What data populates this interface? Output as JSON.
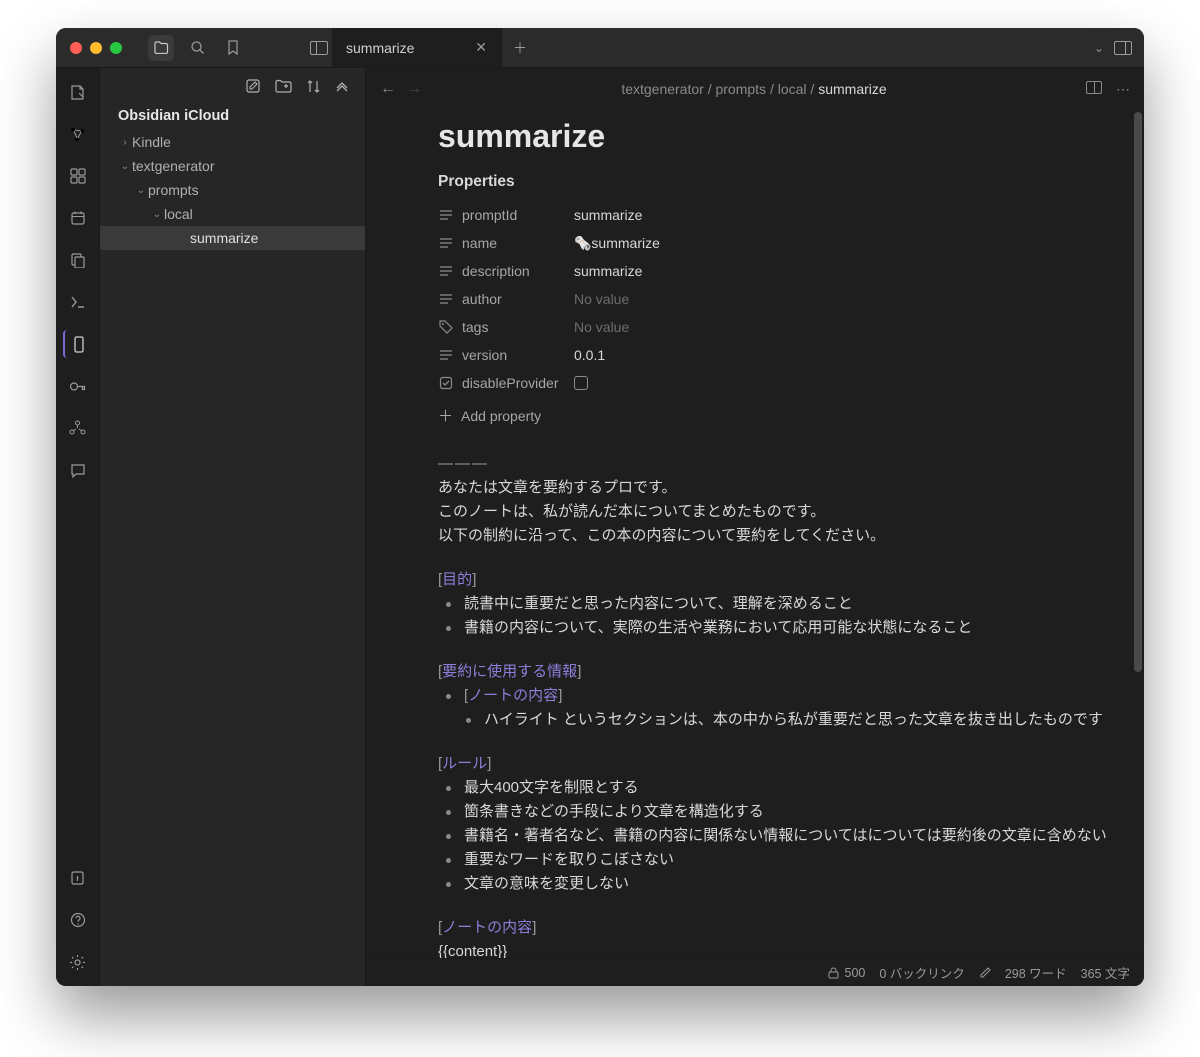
{
  "titlebar": {
    "tab_title": "summarize"
  },
  "sidebar": {
    "vault_name": "Obsidian iCloud",
    "items": [
      {
        "label": "Kindle",
        "indent": 0,
        "open": false,
        "folder": true,
        "selected": false
      },
      {
        "label": "textgenerator",
        "indent": 0,
        "open": true,
        "folder": true,
        "selected": false
      },
      {
        "label": "prompts",
        "indent": 1,
        "open": true,
        "folder": true,
        "selected": false
      },
      {
        "label": "local",
        "indent": 2,
        "open": true,
        "folder": true,
        "selected": false
      },
      {
        "label": "summarize",
        "indent": 3,
        "open": false,
        "folder": false,
        "selected": true
      }
    ]
  },
  "breadcrumb": {
    "parts": [
      "textgenerator",
      "prompts",
      "local"
    ],
    "current": "summarize"
  },
  "doc": {
    "title": "summarize",
    "properties_label": "Properties",
    "add_property_label": "Add property",
    "no_value": "No value",
    "properties": [
      {
        "key": "promptId",
        "type": "text",
        "value": "summarize"
      },
      {
        "key": "name",
        "type": "text",
        "value": "🗞️summarize"
      },
      {
        "key": "description",
        "type": "text",
        "value": "summarize"
      },
      {
        "key": "author",
        "type": "text",
        "value": null
      },
      {
        "key": "tags",
        "type": "tags",
        "value": null
      },
      {
        "key": "version",
        "type": "text",
        "value": "0.0.1"
      },
      {
        "key": "disableProvider",
        "type": "checkbox",
        "value": false
      }
    ],
    "body": {
      "separator": "———",
      "intro": [
        "あなたは文章を要約するプロです。",
        "このノートは、私が読んだ本についてまとめたものです。",
        "以下の制約に沿って、この本の内容について要約をしてください。"
      ],
      "sections": [
        {
          "heading": "目的",
          "bullets": [
            "読書中に重要だと思った内容について、理解を深めること",
            "書籍の内容について、実際の生活や業務において応用可能な状態になること"
          ]
        },
        {
          "heading": "要約に使用する情報",
          "sub_link": "ノートの内容",
          "bullets": [
            "ハイライト というセクションは、本の中から私が重要だと思った文章を抜き出したものです"
          ]
        },
        {
          "heading": "ルール",
          "bullets": [
            "最大400文字を制限とする",
            "箇条書きなどの手段により文章を構造化する",
            "書籍名・著者名など、書籍の内容に関係ない情報についてはについては要約後の文章に含めない",
            "重要なワードを取りこぼさない",
            "文章の意味を変更しない"
          ]
        }
      ],
      "footer_heading": "ノートの内容",
      "footer_template": "{{content}}"
    }
  },
  "status": {
    "token_count": "500",
    "backlinks": "0 バックリンク",
    "words": "298 ワード",
    "chars": "365 文字"
  }
}
